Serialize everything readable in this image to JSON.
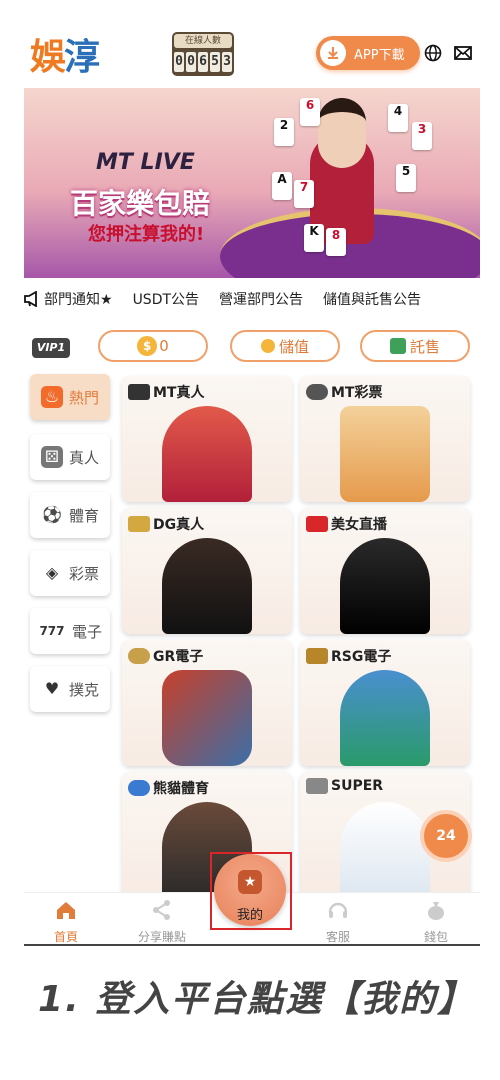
{
  "header": {
    "logo_text": "娛",
    "logo_text2": "淳",
    "online_label": "在線人數",
    "online_digits": [
      "0",
      "0",
      "6",
      "5",
      "3"
    ],
    "app_button": "APP下載",
    "globe_icon": "globe-icon",
    "mail_icon": "mail-icon"
  },
  "banner": {
    "brand": "MT LIVE",
    "headline": "百家樂包賠",
    "subline": "您押注算我的!",
    "cards": [
      "2",
      "6",
      "4",
      "3",
      "A",
      "7",
      "5",
      "K",
      "8"
    ],
    "slide_count": 10,
    "active_slide": 0
  },
  "marquee": {
    "items": [
      "部門通知★",
      "USDT公告",
      "營運部門公告",
      "儲值與託售公告"
    ]
  },
  "wallet": {
    "vip": "VIP1",
    "balance": "0",
    "deposit": "儲值",
    "withdraw": "託售"
  },
  "sidebar": {
    "items": [
      {
        "label": "熱門",
        "icon": "fire-icon"
      },
      {
        "label": "真人",
        "icon": "dice-icon"
      },
      {
        "label": "體育",
        "icon": "soccer-ball-icon"
      },
      {
        "label": "彩票",
        "icon": "lottery-icon"
      },
      {
        "label": "電子",
        "icon": "slot-777-icon"
      },
      {
        "label": "撲克",
        "icon": "poker-card-icon"
      }
    ],
    "active": 0
  },
  "games": [
    {
      "title": "MT真人",
      "logo": "MT"
    },
    {
      "title": "MT彩票",
      "logo": "MT"
    },
    {
      "title": "DG真人",
      "logo": "DG"
    },
    {
      "title": "美女直播",
      "logo": "LIVE"
    },
    {
      "title": "GR電子",
      "logo": "GR"
    },
    {
      "title": "RSG電子",
      "logo": "RSG"
    },
    {
      "title": "熊貓體育",
      "logo": "panda"
    },
    {
      "title": "SUPER",
      "logo": "SUPER"
    }
  ],
  "float_button": "24",
  "nav": {
    "home": "首頁",
    "share": "分享賺點",
    "mine": "我的",
    "service": "客服",
    "wallet": "錢包"
  },
  "caption": "1. 登入平台點選【我的】",
  "colors": {
    "accent": "#f08a4a",
    "highlight_box": "#d9262b"
  }
}
